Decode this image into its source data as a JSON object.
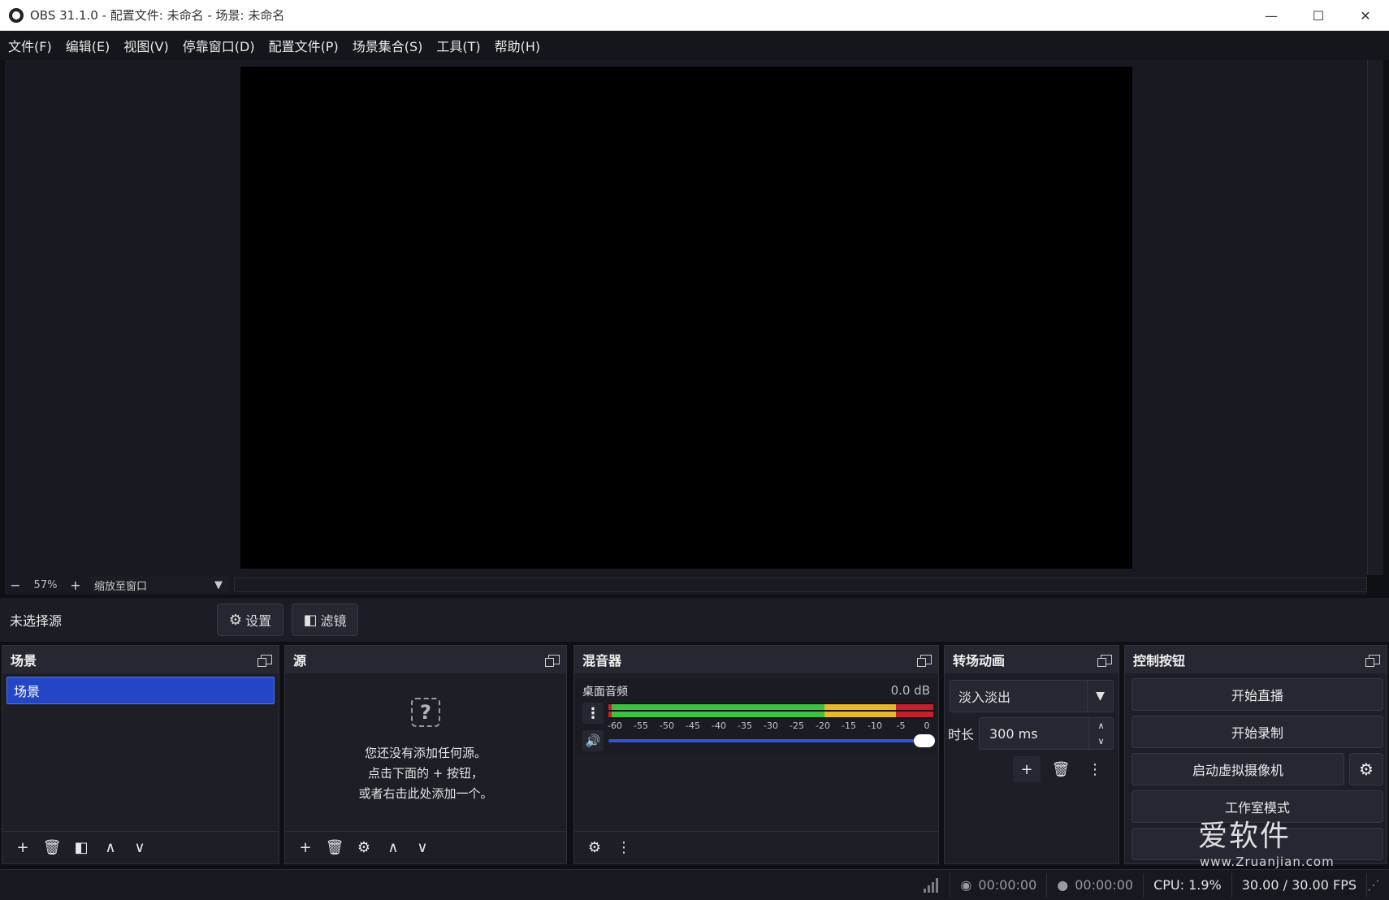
{
  "window": {
    "title": "OBS 31.1.0 - 配置文件: 未命名 - 场景: 未命名",
    "minimize": "—",
    "maximize": "☐",
    "close": "✕"
  },
  "menu": [
    "文件(F)",
    "编辑(E)",
    "视图(V)",
    "停靠窗口(D)",
    "配置文件(P)",
    "场景集合(S)",
    "工具(T)",
    "帮助(H)"
  ],
  "zoom": {
    "minus": "−",
    "percent": "57%",
    "plus": "+",
    "mode": "缩放至窗口"
  },
  "source_toolbar": {
    "no_source": "未选择源",
    "settings": "设置",
    "filters": "滤镜"
  },
  "docks": {
    "scenes": {
      "title": "场景",
      "items": [
        "场景"
      ]
    },
    "sources": {
      "title": "源",
      "empty_line1": "您还没有添加任何源。",
      "empty_line2": "点击下面的 + 按钮，",
      "empty_line3": "或者右击此处添加一个。"
    },
    "mixer": {
      "title": "混音器",
      "channel": "桌面音频",
      "db": "0.0 dB",
      "ticks": [
        "-60",
        "-55",
        "-50",
        "-45",
        "-40",
        "-35",
        "-30",
        "-25",
        "-20",
        "-15",
        "-10",
        "-5",
        "0"
      ],
      "volume_level": 1.0
    },
    "transitions": {
      "title": "转场动画",
      "selected": "淡入淡出",
      "duration_label": "时长",
      "duration_value": "300 ms"
    },
    "controls": {
      "title": "控制按钮",
      "start_stream": "开始直播",
      "start_record": "开始录制",
      "virtual_cam": "启动虚拟摄像机",
      "studio_mode": "工作室模式",
      "exit": ""
    }
  },
  "watermark": {
    "cn": "爱软件",
    "en": "www.Zruanjian.com"
  },
  "status": {
    "stream_time": "00:00:00",
    "record_time": "00:00:00",
    "cpu": "CPU: 1.9%",
    "fps": "30.00 / 30.00 FPS"
  },
  "colors": {
    "accent_blue": "#2346c7",
    "meter_green": "#3ec13e",
    "meter_yellow": "#e8b82a",
    "meter_red": "#c4202d"
  },
  "icons": {
    "gear": "⚙",
    "plus": "+",
    "trash": "🗑",
    "up": "∧",
    "down": "∨",
    "dots": "⋮",
    "speaker": "🔊",
    "question": "?"
  }
}
